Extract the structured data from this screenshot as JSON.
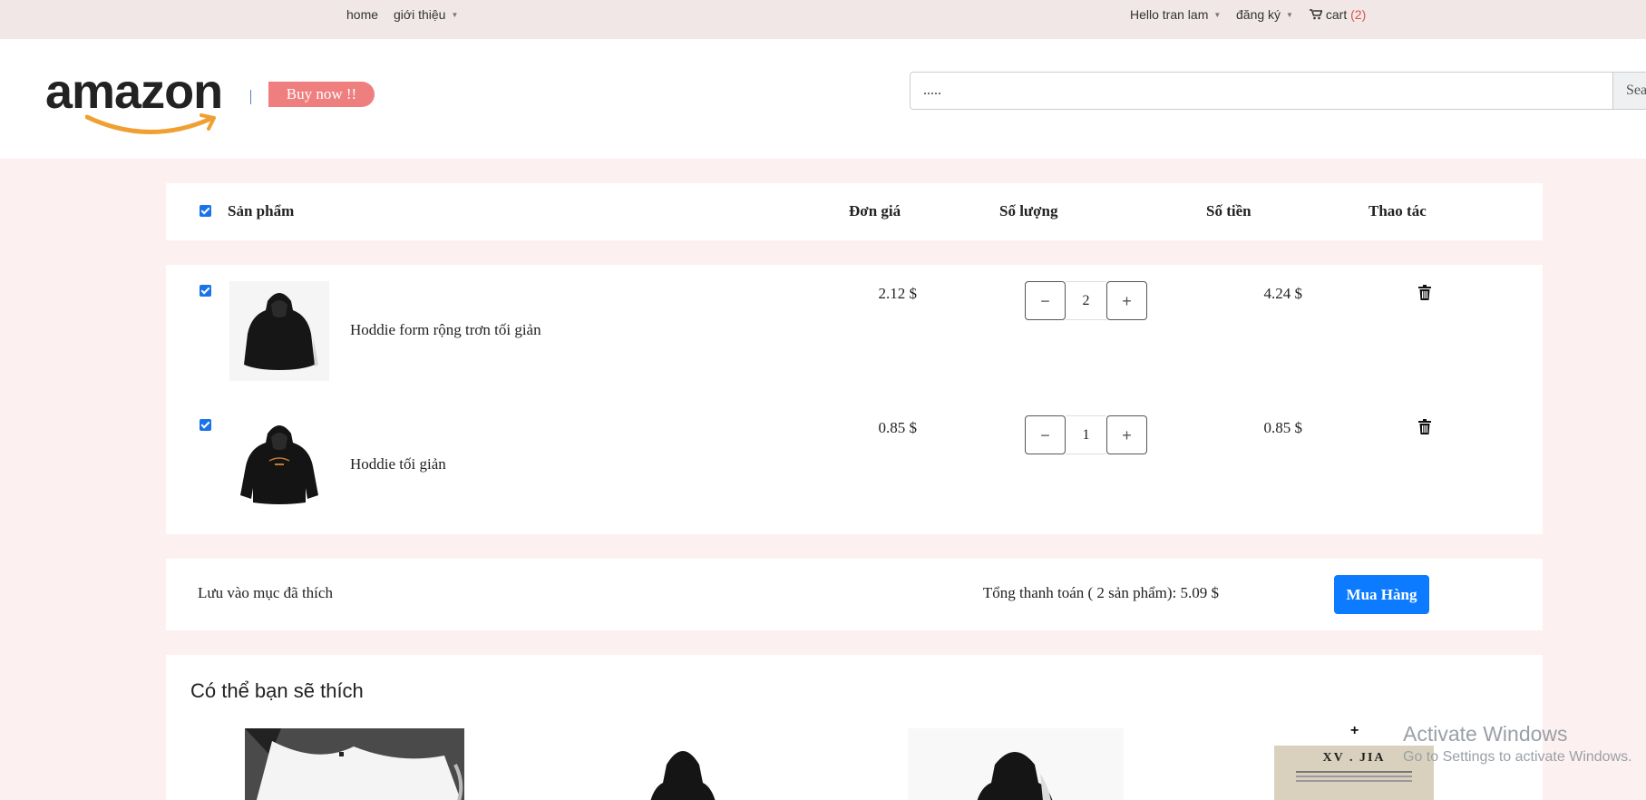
{
  "topbar": {
    "home": "home",
    "intro": "giới thiệu",
    "greeting": "Hello tran lam",
    "register": "đăng ký",
    "cart_label": "cart",
    "cart_count": "(2)"
  },
  "header": {
    "logo": "amazon",
    "buy_now": "Buy now !!",
    "search_value": ".....",
    "search_button": "Search"
  },
  "cart_table": {
    "headers": {
      "product": "Sản phẩm",
      "unit_price": "Đơn giá",
      "quantity": "Số lượng",
      "amount": "Số tiền",
      "action": "Thao tác"
    },
    "items": [
      {
        "name": "Hoddie form rộng trơn tối giản",
        "unit_price": "2.12 $",
        "quantity": "2",
        "amount": "4.24 $",
        "checked": true
      },
      {
        "name": "Hoddie tối giản",
        "unit_price": "0.85 $",
        "quantity": "1",
        "amount": "0.85 $",
        "checked": true
      }
    ]
  },
  "summary": {
    "save_favorites": "Lưu vào mục đã thích",
    "total": "Tổng thanh toán ( 2 sản phẩm): 5.09 $",
    "checkout": "Mua Hàng"
  },
  "suggestions": {
    "title": "Có thể bạn sẽ thích",
    "card4_brand": "XV . JIA"
  },
  "watermark": {
    "line1": "Activate Windows",
    "line2": "Go to Settings to activate Windows."
  },
  "colors": {
    "accent": "#0d7bff",
    "buy_now": "#ef7f7f",
    "cart_count": "#d9534f",
    "logo_smile": "#f0a033"
  }
}
